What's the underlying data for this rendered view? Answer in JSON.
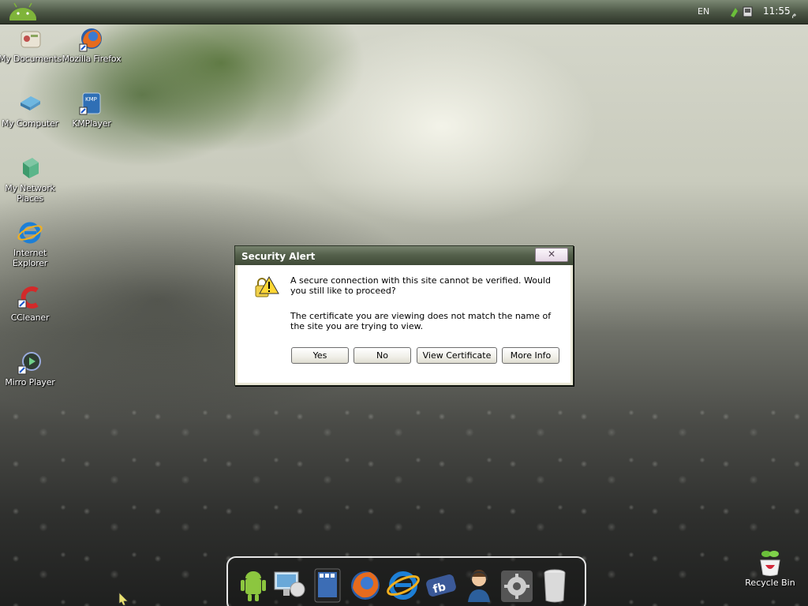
{
  "topbar": {
    "language": "EN",
    "clock": "11:55",
    "clock_suffix": "م"
  },
  "desktop": {
    "icons": [
      {
        "label": "My Documents",
        "icon": "my-documents-icon"
      },
      {
        "label": "Mozilla Firefox",
        "icon": "firefox-icon"
      },
      {
        "label": "My Computer",
        "icon": "my-computer-icon"
      },
      {
        "label": "KMPlayer",
        "icon": "kmplayer-icon"
      },
      {
        "label": "My Network Places",
        "icon": "network-places-icon"
      },
      {
        "label": "Internet Explorer",
        "icon": "internet-explorer-icon"
      },
      {
        "label": "CCleaner",
        "icon": "ccleaner-icon"
      },
      {
        "label": "Mirro Player",
        "icon": "mirro-player-icon"
      }
    ],
    "recycle_bin": "Recycle Bin"
  },
  "dialog": {
    "title": "Security Alert",
    "close_glyph": "✕",
    "message_1": "A secure connection with this site cannot be verified. Would you still like to proceed?",
    "message_2": "The certificate you are viewing does not match the name of the site you are trying to view.",
    "buttons": {
      "yes": "Yes",
      "no": "No",
      "view_certificate": "View Certificate",
      "more_info": "More Info"
    }
  },
  "dock": {
    "items": [
      "android-icon",
      "network-computer-icon",
      "tablet-icon",
      "firefox-icon",
      "internet-explorer-icon",
      "facebook-icon",
      "support-agent-icon",
      "settings-gear-icon",
      "trash-can-icon"
    ]
  },
  "colors": {
    "titlebar": "#55614c",
    "dialog_bg": "#ffffff",
    "close_button": "#e6d7e6"
  }
}
